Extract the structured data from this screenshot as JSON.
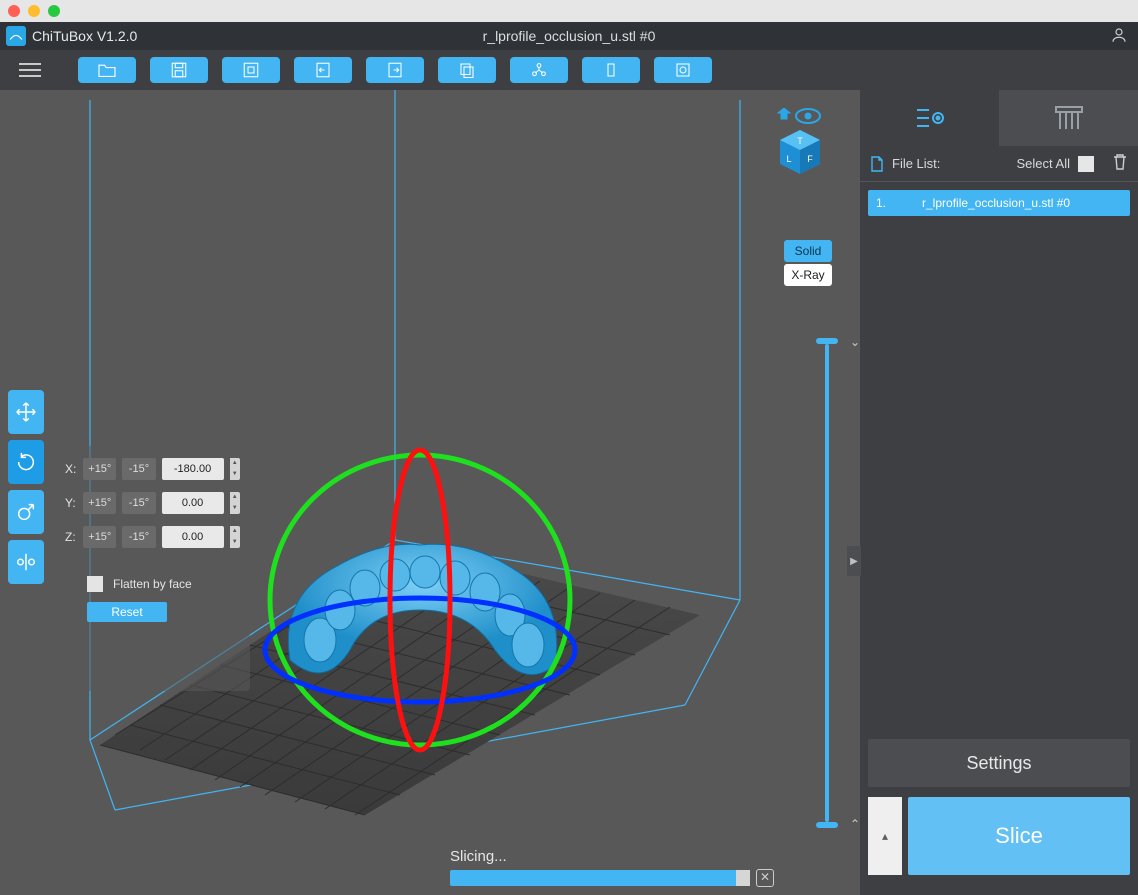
{
  "app": {
    "title": "ChiTuBox V1.2.0",
    "document": "r_lprofile_occlusion_u.stl #0"
  },
  "toolbar": {
    "open": "open-icon",
    "save": "save-icon",
    "screenshot": "screenshot-icon",
    "import": "import-icon",
    "export": "export-icon",
    "copy": "copy-icon",
    "autolayout": "autolayout-icon",
    "hollow": "hollow-icon",
    "repair": "repair-icon"
  },
  "view_mode": {
    "solid": "Solid",
    "xray": "X-Ray"
  },
  "rotate_panel": {
    "x": {
      "label": "X:",
      "plus": "+15°",
      "minus": "-15°",
      "value": "-180.00"
    },
    "y": {
      "label": "Y:",
      "plus": "+15°",
      "minus": "-15°",
      "value": "0.00"
    },
    "z": {
      "label": "Z:",
      "plus": "+15°",
      "minus": "-15°",
      "value": "0.00"
    },
    "flatten_label": "Flatten by face",
    "reset": "Reset"
  },
  "file_list": {
    "header": "File List:",
    "select_all": "Select All",
    "items": [
      {
        "index": "1.",
        "name": "r_lprofile_occlusion_u.stl #0"
      }
    ]
  },
  "settings_btn": "Settings",
  "slice_btn": "Slice",
  "slicing_status": "Slicing..."
}
